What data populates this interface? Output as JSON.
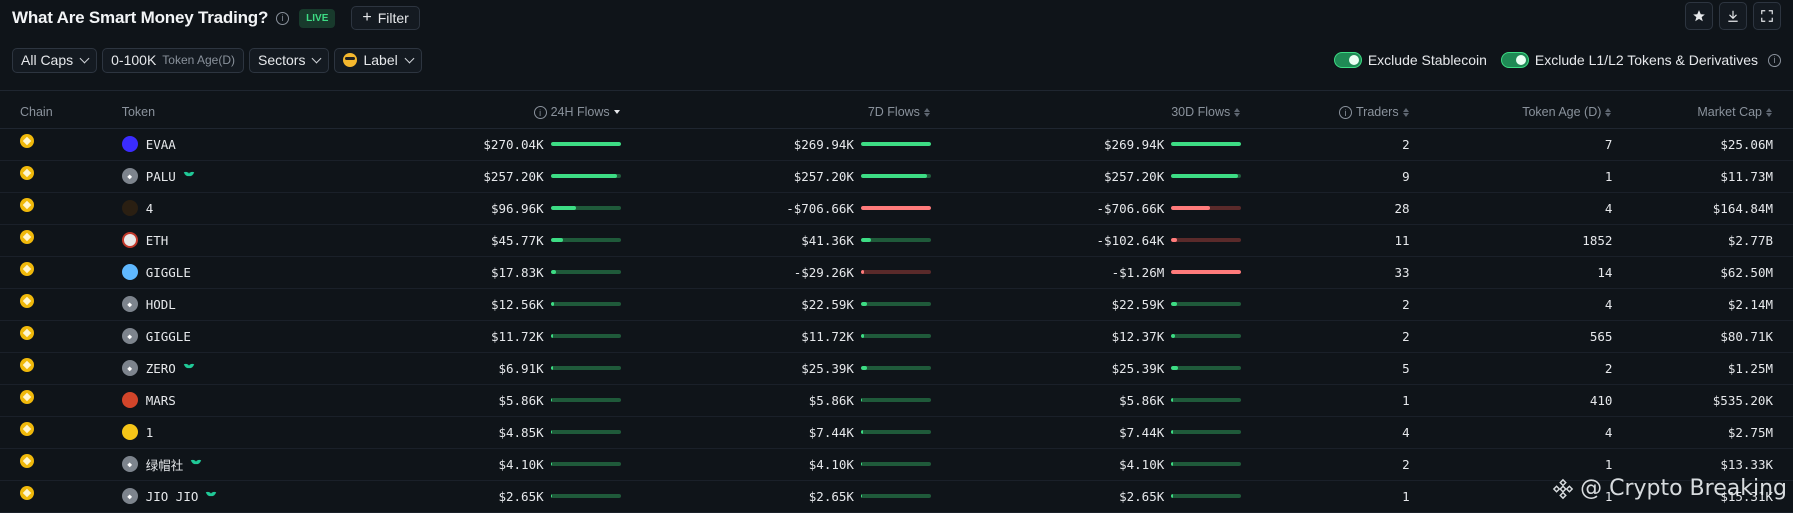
{
  "header": {
    "title": "What Are Smart Money Trading?",
    "live_badge": "LIVE",
    "filter_label": "Filter"
  },
  "filters": {
    "caps": "All Caps",
    "token_age_range": "0-100K",
    "token_age_label": "Token Age(D)",
    "sectors": "Sectors",
    "label": "Label"
  },
  "toggles": [
    {
      "label": "Exclude Stablecoin",
      "on": true
    },
    {
      "label": "Exclude L1/L2 Tokens & Derivatives",
      "on": true
    }
  ],
  "columns": {
    "chain": "Chain",
    "token": "Token",
    "flows_24h": "24H Flows",
    "flows_7d": "7D Flows",
    "flows_30d": "30D Flows",
    "traders": "Traders",
    "token_age": "Token Age (D)",
    "market_cap": "Market Cap"
  },
  "accent_colors": {
    "positive": "#3ddc84",
    "negative": "#ff7b7b",
    "chain_bnb": "#f0b90b"
  },
  "rows": [
    {
      "token": "EVAA",
      "icon": "evaa-logo",
      "icon_color": "#3b2cff",
      "tag": false,
      "f24": "$270.04K",
      "f24_pct": 1.0,
      "f24_neg": false,
      "f7": "$269.94K",
      "f7_pct": 1.0,
      "f7_neg": false,
      "f30": "$269.94K",
      "f30_pct": 1.0,
      "f30_neg": false,
      "traders": "2",
      "age": "7",
      "mcap": "$25.06M"
    },
    {
      "token": "PALU",
      "icon": "generic-token",
      "icon_color": "#7d848d",
      "tag": true,
      "f24": "$257.20K",
      "f24_pct": 0.95,
      "f24_neg": false,
      "f7": "$257.20K",
      "f7_pct": 0.95,
      "f7_neg": false,
      "f30": "$257.20K",
      "f30_pct": 0.95,
      "f30_neg": false,
      "traders": "9",
      "age": "1",
      "mcap": "$11.73M"
    },
    {
      "token": "4",
      "icon": "hand-logo",
      "icon_color": "#2a1f12",
      "tag": false,
      "f24": "$96.96K",
      "f24_pct": 0.36,
      "f24_neg": false,
      "f7": "-$706.66K",
      "f7_pct": 1.0,
      "f7_neg": true,
      "f30": "-$706.66K",
      "f30_pct": 0.55,
      "f30_neg": true,
      "traders": "28",
      "age": "4",
      "mcap": "$164.84M"
    },
    {
      "token": "ETH",
      "icon": "weth-logo",
      "icon_color": "#e8e8e8",
      "tag": false,
      "f24": "$45.77K",
      "f24_pct": 0.17,
      "f24_neg": false,
      "f7": "$41.36K",
      "f7_pct": 0.15,
      "f7_neg": false,
      "f30": "-$102.64K",
      "f30_pct": 0.08,
      "f30_neg": true,
      "traders": "11",
      "age": "1852",
      "mcap": "$2.77B"
    },
    {
      "token": "GIGGLE",
      "icon": "giggle-logo",
      "icon_color": "#5fb8ff",
      "tag": false,
      "f24": "$17.83K",
      "f24_pct": 0.07,
      "f24_neg": false,
      "f7": "-$29.26K",
      "f7_pct": 0.04,
      "f7_neg": true,
      "f30": "-$1.26M",
      "f30_pct": 1.0,
      "f30_neg": true,
      "traders": "33",
      "age": "14",
      "mcap": "$62.50M"
    },
    {
      "token": "HODL",
      "icon": "generic-token",
      "icon_color": "#7d848d",
      "tag": false,
      "f24": "$12.56K",
      "f24_pct": 0.05,
      "f24_neg": false,
      "f7": "$22.59K",
      "f7_pct": 0.08,
      "f7_neg": false,
      "f30": "$22.59K",
      "f30_pct": 0.08,
      "f30_neg": false,
      "traders": "2",
      "age": "4",
      "mcap": "$2.14M"
    },
    {
      "token": "GIGGLE",
      "icon": "generic-token",
      "icon_color": "#7d848d",
      "tag": false,
      "f24": "$11.72K",
      "f24_pct": 0.04,
      "f24_neg": false,
      "f7": "$11.72K",
      "f7_pct": 0.04,
      "f7_neg": false,
      "f30": "$12.37K",
      "f30_pct": 0.05,
      "f30_neg": false,
      "traders": "2",
      "age": "565",
      "mcap": "$80.71K"
    },
    {
      "token": "ZERO",
      "icon": "generic-token",
      "icon_color": "#7d848d",
      "tag": true,
      "f24": "$6.91K",
      "f24_pct": 0.03,
      "f24_neg": false,
      "f7": "$25.39K",
      "f7_pct": 0.09,
      "f7_neg": false,
      "f30": "$25.39K",
      "f30_pct": 0.09,
      "f30_neg": false,
      "traders": "5",
      "age": "2",
      "mcap": "$1.25M"
    },
    {
      "token": "MARS",
      "icon": "mars-logo",
      "icon_color": "#d2452a",
      "tag": false,
      "f24": "$5.86K",
      "f24_pct": 0.02,
      "f24_neg": false,
      "f7": "$5.86K",
      "f7_pct": 0.02,
      "f7_neg": false,
      "f30": "$5.86K",
      "f30_pct": 0.02,
      "f30_neg": false,
      "traders": "1",
      "age": "410",
      "mcap": "$535.20K"
    },
    {
      "token": "1",
      "icon": "coin-logo",
      "icon_color": "#f5c518",
      "tag": false,
      "f24": "$4.85K",
      "f24_pct": 0.02,
      "f24_neg": false,
      "f7": "$7.44K",
      "f7_pct": 0.03,
      "f7_neg": false,
      "f30": "$7.44K",
      "f30_pct": 0.03,
      "f30_neg": false,
      "traders": "4",
      "age": "4",
      "mcap": "$2.75M"
    },
    {
      "token": "绿帽社",
      "icon": "generic-token",
      "icon_color": "#7d848d",
      "tag": true,
      "f24": "$4.10K",
      "f24_pct": 0.015,
      "f24_neg": false,
      "f7": "$4.10K",
      "f7_pct": 0.015,
      "f7_neg": false,
      "f30": "$4.10K",
      "f30_pct": 0.015,
      "f30_neg": false,
      "traders": "2",
      "age": "1",
      "mcap": "$13.33K"
    },
    {
      "token": "JIO JIO",
      "icon": "generic-token",
      "icon_color": "#7d848d",
      "tag": true,
      "f24": "$2.65K",
      "f24_pct": 0.01,
      "f24_neg": false,
      "f7": "$2.65K",
      "f7_pct": 0.01,
      "f7_neg": false,
      "f30": "$2.65K",
      "f30_pct": 0.01,
      "f30_neg": false,
      "traders": "1",
      "age": "1",
      "mcap": "$15.31K"
    }
  ],
  "watermark": "@ Crypto Breaking"
}
